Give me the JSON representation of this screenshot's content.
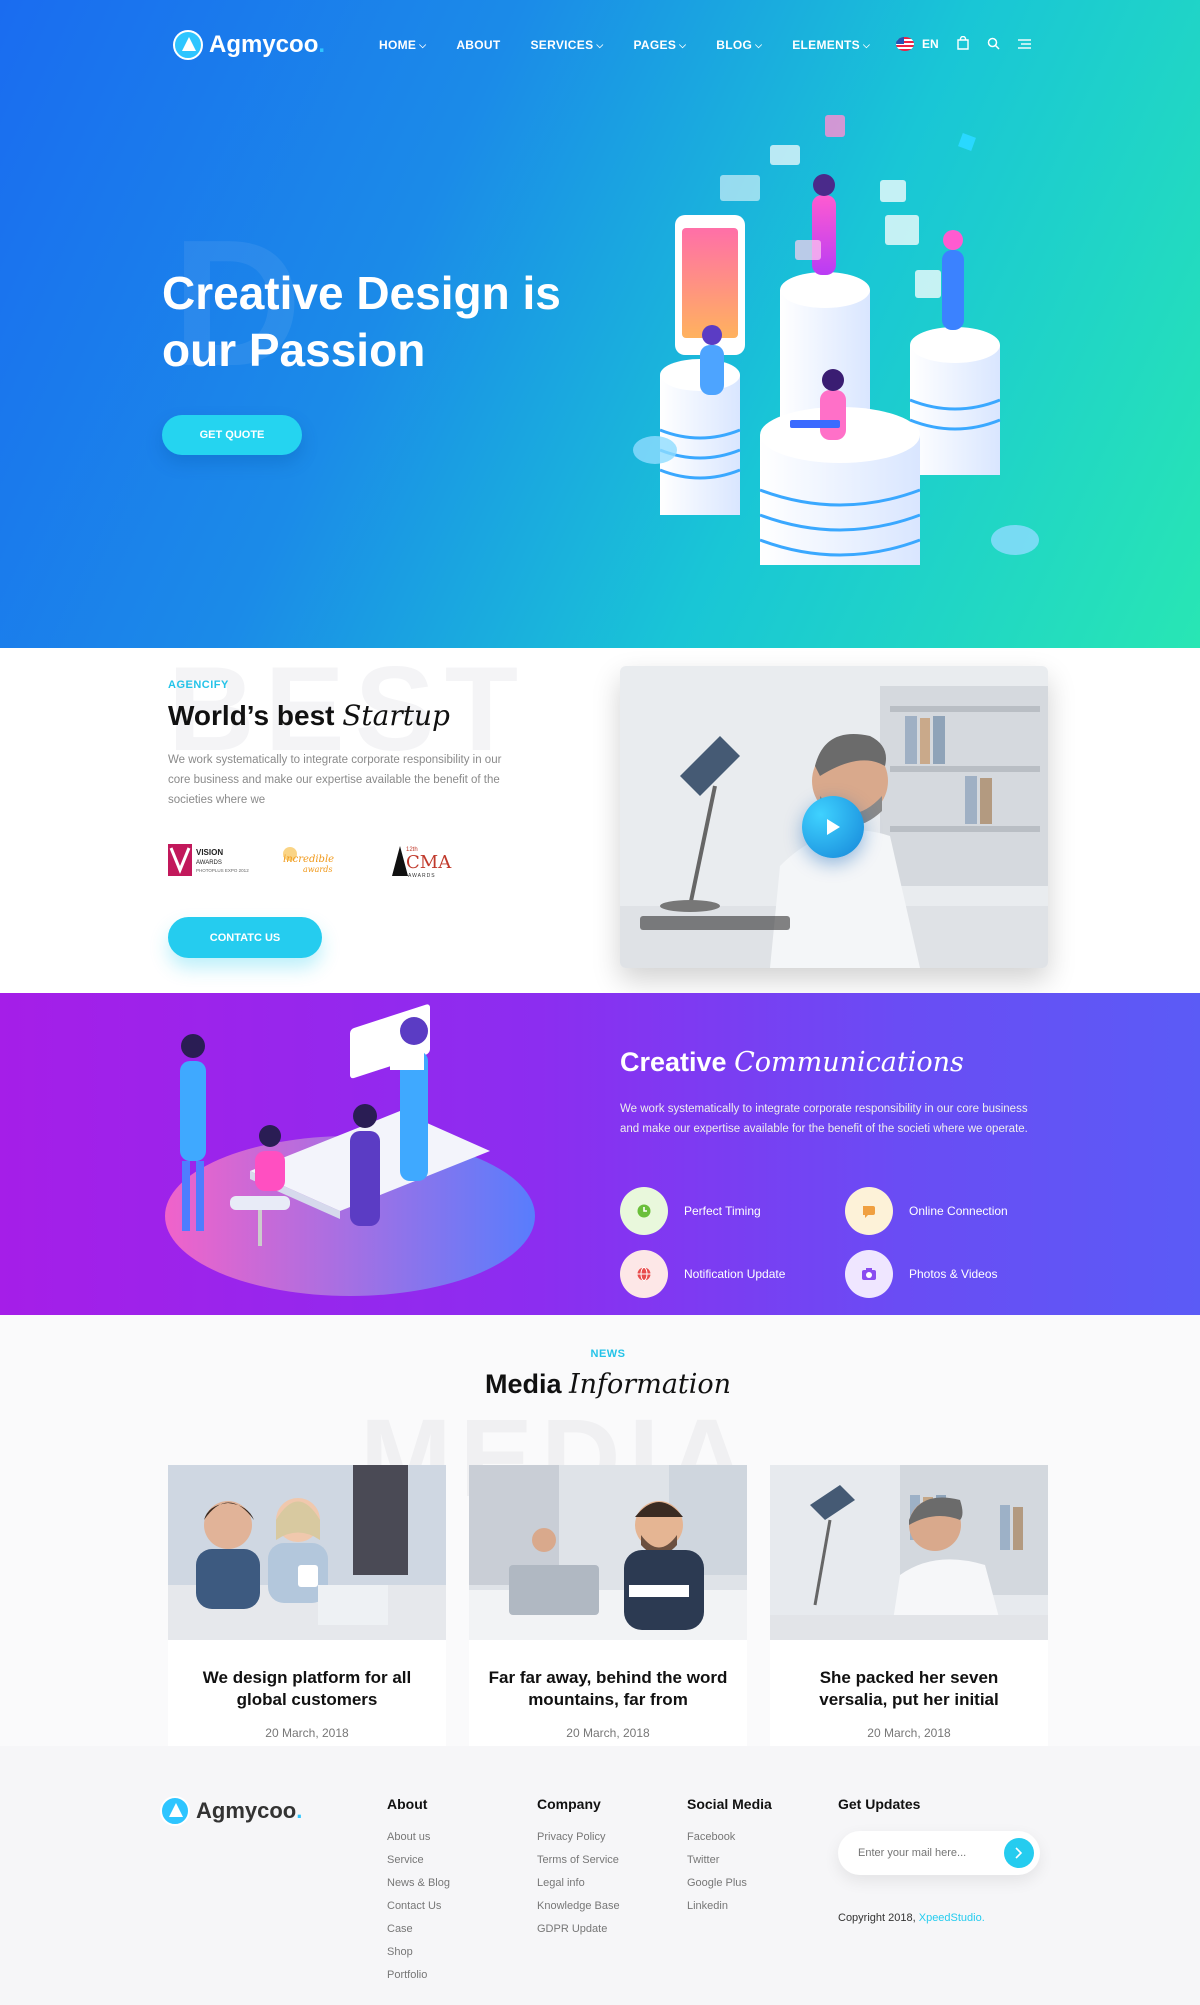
{
  "brand": {
    "name": "Agmycoo",
    "dot": "."
  },
  "nav": {
    "items": [
      {
        "label": "HOME",
        "dropdown": true
      },
      {
        "label": "ABOUT",
        "dropdown": false
      },
      {
        "label": "SERVICES",
        "dropdown": true
      },
      {
        "label": "PAGES",
        "dropdown": true
      },
      {
        "label": "BLOG",
        "dropdown": true
      },
      {
        "label": "ELEMENTS",
        "dropdown": true
      }
    ],
    "language": "EN",
    "icons": [
      "us-flag-icon",
      "shopping-bag-icon",
      "search-icon",
      "hamburger-menu-icon"
    ]
  },
  "hero": {
    "bg_letter": "D",
    "title_line1": "Creative Design is",
    "title_line2": "our Passion",
    "cta": "GET QUOTE"
  },
  "about": {
    "bg_word": "BEST",
    "eyebrow": "AGENCIFY",
    "title_plain": "World’s best",
    "title_italic": "Startup",
    "text": "We work systematically to integrate corporate responsibility in our core business and make our expertise available the benefit of the societies where we",
    "awards": [
      {
        "title": "VISION",
        "sub": "AWARDS",
        "line": "PHOTOPLUS EXPO 2012"
      },
      {
        "title": "incredible",
        "sub": "awards"
      },
      {
        "title": "CMA",
        "sup": "12th",
        "sub": "AWARDS"
      }
    ],
    "cta": "CONTATC US"
  },
  "features": {
    "title_plain": "Creative",
    "title_italic": "Communications",
    "text": "We work systematically to integrate corporate responsibility in our core business and make our expertise available for the benefit of the societi where we operate.",
    "items": [
      {
        "label": "Perfect Timing",
        "icon": "clock-icon",
        "color": "#e9f8dc",
        "fg": "#6abf3a"
      },
      {
        "label": "Online Connection",
        "icon": "chat-icon",
        "color": "#fdf2d8",
        "fg": "#f0a040"
      },
      {
        "label": "Notification Update",
        "icon": "globe-icon",
        "color": "#fde7e7",
        "fg": "#e84c4c"
      },
      {
        "label": "Photos & Videos",
        "icon": "camera-icon",
        "color": "#efe6ff",
        "fg": "#8a4cf0"
      }
    ]
  },
  "news": {
    "bg_word": "MEDIA",
    "eyebrow": "NEWS",
    "title_plain": "Media",
    "title_italic": "Information",
    "cards": [
      {
        "title": "We design platform for all global customers",
        "date": "20 March, 2018"
      },
      {
        "title": "Far far away, behind the word mountains, far from",
        "date": "20 March, 2018"
      },
      {
        "title": "She packed her seven versalia, put her initial",
        "date": "20 March, 2018"
      }
    ]
  },
  "footer": {
    "columns": [
      {
        "title": "About",
        "links": [
          "About us",
          "Service",
          "News & Blog",
          "Contact Us",
          "Case",
          "Shop",
          "Portfolio"
        ]
      },
      {
        "title": "Company",
        "links": [
          "Privacy Policy",
          "Terms of Service",
          "Legal info",
          "Knowledge Base",
          "GDPR Update"
        ]
      },
      {
        "title": "Social Media",
        "links": [
          "Facebook",
          "Twitter",
          "Google Plus",
          "Linkedin"
        ]
      }
    ],
    "updates_title": "Get Updates",
    "email_placeholder": "Enter your mail here...",
    "copyright_prefix": "Copyright 2018,",
    "copyright_brand": "XpeedStudio."
  },
  "colors": {
    "accent": "#25ccef",
    "hero_start": "#1a6cf0",
    "hero_end": "#28e6b4",
    "purple_start": "#a51ee8",
    "purple_end": "#5b5bf6"
  }
}
